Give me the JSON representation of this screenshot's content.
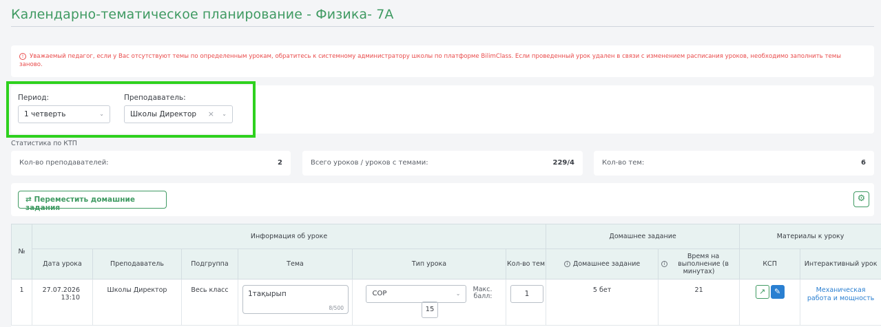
{
  "page": {
    "title": "Календарно-тематическое планирование - Физика- 7А"
  },
  "alert": {
    "icon": "info-circle-icon",
    "text": "Уважаемый педагог, если у Вас отсутствуют темы по определенным урокам, обратитесь к системному администратору школы по платформе BilimClass. Если проведенный урок удален в связи с изменением расписания уроков, необходимо заполнить темы заново.",
    "color": "#e94b4b"
  },
  "filters": {
    "period_label": "Период:",
    "period_value": "1 четверть",
    "teacher_label": "Преподаватель:",
    "teacher_value": "Школы Директор"
  },
  "stats": {
    "title": "Статистика по КТП",
    "teachers_label": "Кол-во преподавателей:",
    "teachers_value": "2",
    "lessons_label": "Всего уроков / уроков с темами:",
    "lessons_value": "229/4",
    "topics_label": "Кол-во тем:",
    "topics_value": "6"
  },
  "toolbar": {
    "move_label": "⇄ Переместить домашние задания",
    "settings_icon": "gear-icon"
  },
  "table": {
    "headers": {
      "num": "№",
      "lesson_info": "Информация об уроке",
      "homework": "Домашнее задание",
      "materials": "Материалы к уроку",
      "date": "Дата урока",
      "teacher": "Преподаватель",
      "subgroup": "Подгруппа",
      "topic": "Тема",
      "lesson_type": "Тип урока",
      "topic_count": "Кол-во тем",
      "hw": "Домашнее задание",
      "time": "Время на выполнение (в минутах)",
      "ksp": "КСП",
      "interactive": "Интерактивный урок"
    },
    "rows": [
      {
        "num": "1",
        "date": "27.07.2026",
        "time": "13:10",
        "teacher": "Школы Директор",
        "subgroup": "Весь класс",
        "topic": "1тақырып",
        "topic_chars": "8/500",
        "lesson_type": "СОР",
        "max_label_1": "Макс.",
        "max_label_2": "балл:",
        "max_value": "15",
        "topic_count": "1",
        "homework": "5 бет",
        "minutes": "21",
        "interactive": "Механическая работа и мощность"
      }
    ]
  },
  "colors": {
    "accent": "#3f9a62",
    "highlight": "#2ed11e",
    "link": "#2a7fd1",
    "header_bg": "#e8f2f1"
  }
}
